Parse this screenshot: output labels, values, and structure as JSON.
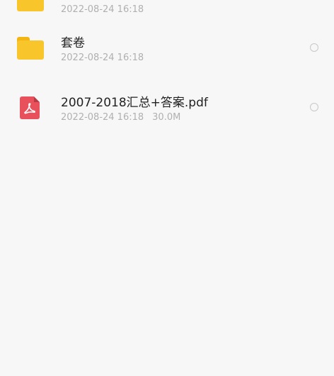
{
  "files": [
    {
      "name": "",
      "date": "2022-08-24 16:18",
      "size": "",
      "type": "folder",
      "icon": "folder-icon"
    },
    {
      "name": "套卷",
      "date": "2022-08-24 16:18",
      "size": "",
      "type": "folder",
      "icon": "folder-icon"
    },
    {
      "name": "2007-2018汇总+答案.pdf",
      "date": "2022-08-24 16:18",
      "size": "30.0M",
      "type": "pdf",
      "icon": "pdf-file-icon"
    }
  ],
  "colors": {
    "folder": "#f8c62a",
    "pdf": "#e8505b",
    "text_primary": "#222222",
    "text_secondary": "#b0b0b0",
    "background": "#f7f7f7"
  }
}
